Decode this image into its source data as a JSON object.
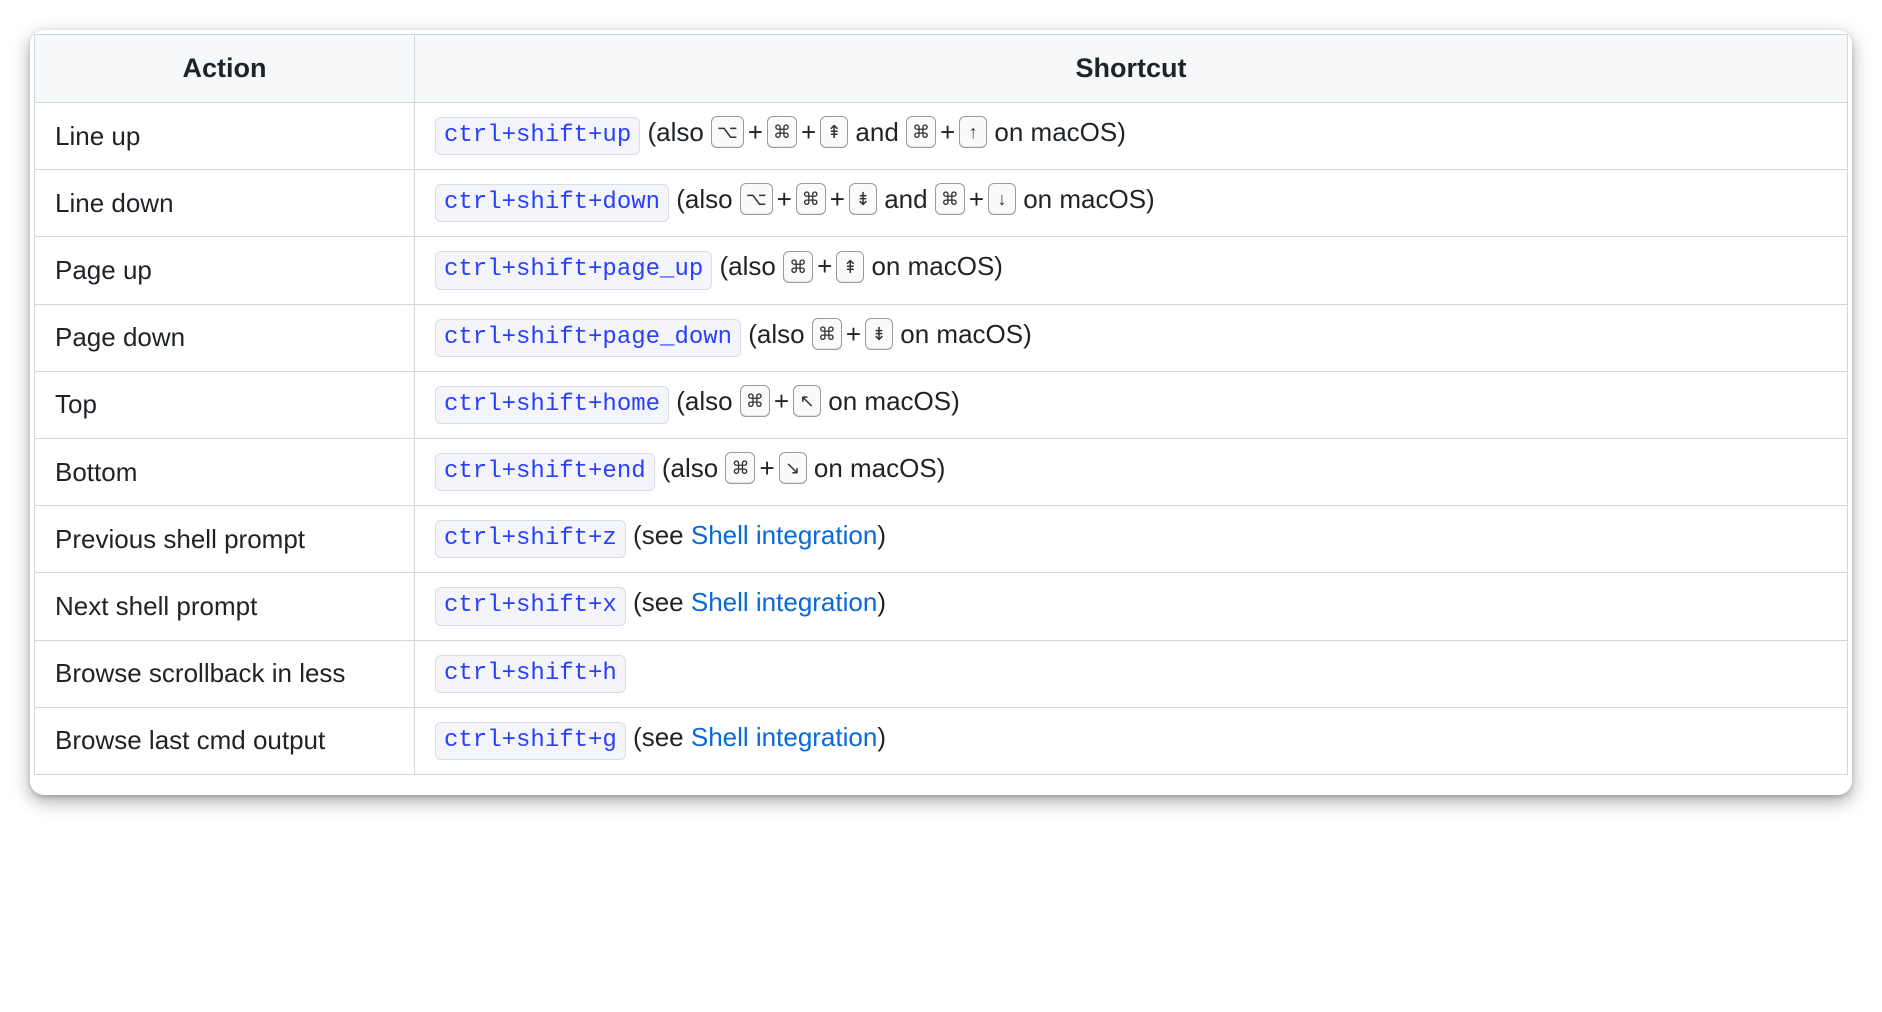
{
  "headers": {
    "action": "Action",
    "shortcut": "Shortcut"
  },
  "glyphs": {
    "option": "⌥",
    "command": "⌘",
    "page_up": "⇞",
    "page_down": "⇟",
    "up": "↑",
    "down": "↓",
    "home": "↖",
    "end": "↘"
  },
  "text": {
    "also_open": " (also ",
    "and": " and ",
    "on_macos_close": " on macOS)",
    "see_open": " (see ",
    "close_paren": ")",
    "plus": "+"
  },
  "links": {
    "shell_integration": "Shell integration"
  },
  "rows": [
    {
      "action": "Line up",
      "code": "ctrl+shift+up",
      "mac_combo_a": [
        "option",
        "command",
        "page_up"
      ],
      "mac_combo_b": [
        "command",
        "up"
      ]
    },
    {
      "action": "Line down",
      "code": "ctrl+shift+down",
      "mac_combo_a": [
        "option",
        "command",
        "page_down"
      ],
      "mac_combo_b": [
        "command",
        "down"
      ]
    },
    {
      "action": "Page up",
      "code": "ctrl+shift+page_up",
      "mac_combo_a": [
        "command",
        "page_up"
      ]
    },
    {
      "action": "Page down",
      "code": "ctrl+shift+page_down",
      "mac_combo_a": [
        "command",
        "page_down"
      ]
    },
    {
      "action": "Top",
      "code": "ctrl+shift+home",
      "mac_combo_a": [
        "command",
        "home"
      ]
    },
    {
      "action": "Bottom",
      "code": "ctrl+shift+end",
      "mac_combo_a": [
        "command",
        "end"
      ]
    },
    {
      "action": "Previous shell prompt",
      "code": "ctrl+shift+z",
      "see_link": "shell_integration"
    },
    {
      "action": "Next shell prompt",
      "code": "ctrl+shift+x",
      "see_link": "shell_integration"
    },
    {
      "action": "Browse scrollback in less",
      "code": "ctrl+shift+h"
    },
    {
      "action": "Browse last cmd output",
      "code": "ctrl+shift+g",
      "see_link": "shell_integration"
    }
  ]
}
